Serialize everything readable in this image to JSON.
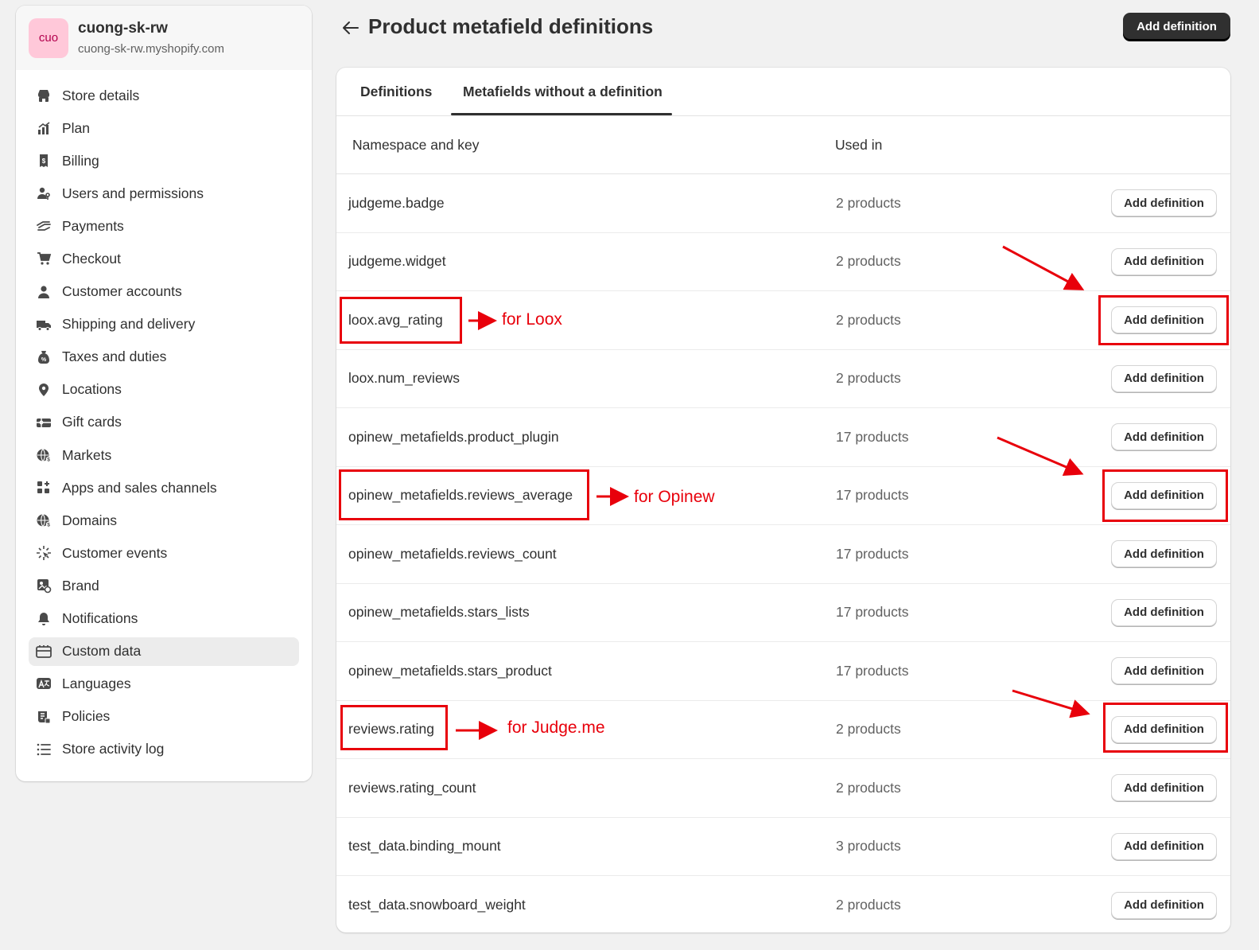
{
  "store": {
    "avatar_text": "cuo",
    "name": "cuong-sk-rw",
    "domain": "cuong-sk-rw.myshopify.com"
  },
  "nav": [
    {
      "label": "Store details",
      "icon": "store-icon"
    },
    {
      "label": "Plan",
      "icon": "plan-icon"
    },
    {
      "label": "Billing",
      "icon": "billing-icon"
    },
    {
      "label": "Users and permissions",
      "icon": "users-icon"
    },
    {
      "label": "Payments",
      "icon": "payments-icon"
    },
    {
      "label": "Checkout",
      "icon": "cart-icon"
    },
    {
      "label": "Customer accounts",
      "icon": "person-icon"
    },
    {
      "label": "Shipping and delivery",
      "icon": "truck-icon"
    },
    {
      "label": "Taxes and duties",
      "icon": "tax-icon"
    },
    {
      "label": "Locations",
      "icon": "location-icon"
    },
    {
      "label": "Gift cards",
      "icon": "gift-card-icon"
    },
    {
      "label": "Markets",
      "icon": "globe-icon"
    },
    {
      "label": "Apps and sales channels",
      "icon": "apps-icon"
    },
    {
      "label": "Domains",
      "icon": "globe-icon"
    },
    {
      "label": "Customer events",
      "icon": "cursor-icon"
    },
    {
      "label": "Brand",
      "icon": "brand-icon"
    },
    {
      "label": "Notifications",
      "icon": "bell-icon"
    },
    {
      "label": "Custom data",
      "icon": "database-icon",
      "active": true
    },
    {
      "label": "Languages",
      "icon": "language-icon"
    },
    {
      "label": "Policies",
      "icon": "policy-icon"
    },
    {
      "label": "Store activity log",
      "icon": "list-icon"
    }
  ],
  "header": {
    "title": "Product metafield definitions",
    "primary_button": "Add definition"
  },
  "tabs": [
    {
      "label": "Definitions"
    },
    {
      "label": "Metafields without a definition",
      "selected": true
    }
  ],
  "table": {
    "columns": [
      "Namespace and key",
      "Used in"
    ],
    "action_label": "Add definition",
    "rows": [
      {
        "key": "judgeme.badge",
        "used_in": "2 products"
      },
      {
        "key": "judgeme.widget",
        "used_in": "2 products"
      },
      {
        "key": "loox.avg_rating",
        "used_in": "2 products"
      },
      {
        "key": "loox.num_reviews",
        "used_in": "2 products"
      },
      {
        "key": "opinew_metafields.product_plugin",
        "used_in": "17 products"
      },
      {
        "key": "opinew_metafields.reviews_average",
        "used_in": "17 products"
      },
      {
        "key": "opinew_metafields.reviews_count",
        "used_in": "17 products"
      },
      {
        "key": "opinew_metafields.stars_lists",
        "used_in": "17 products"
      },
      {
        "key": "opinew_metafields.stars_product",
        "used_in": "17 products"
      },
      {
        "key": "reviews.rating",
        "used_in": "2 products"
      },
      {
        "key": "reviews.rating_count",
        "used_in": "2 products"
      },
      {
        "key": "test_data.binding_mount",
        "used_in": "3 products"
      },
      {
        "key": "test_data.snowboard_weight",
        "used_in": "2 products"
      }
    ]
  },
  "annotations": {
    "loox": "for Loox",
    "opinew": "for Opinew",
    "judgeme": "for Judge.me",
    "color": "#e8000b"
  }
}
